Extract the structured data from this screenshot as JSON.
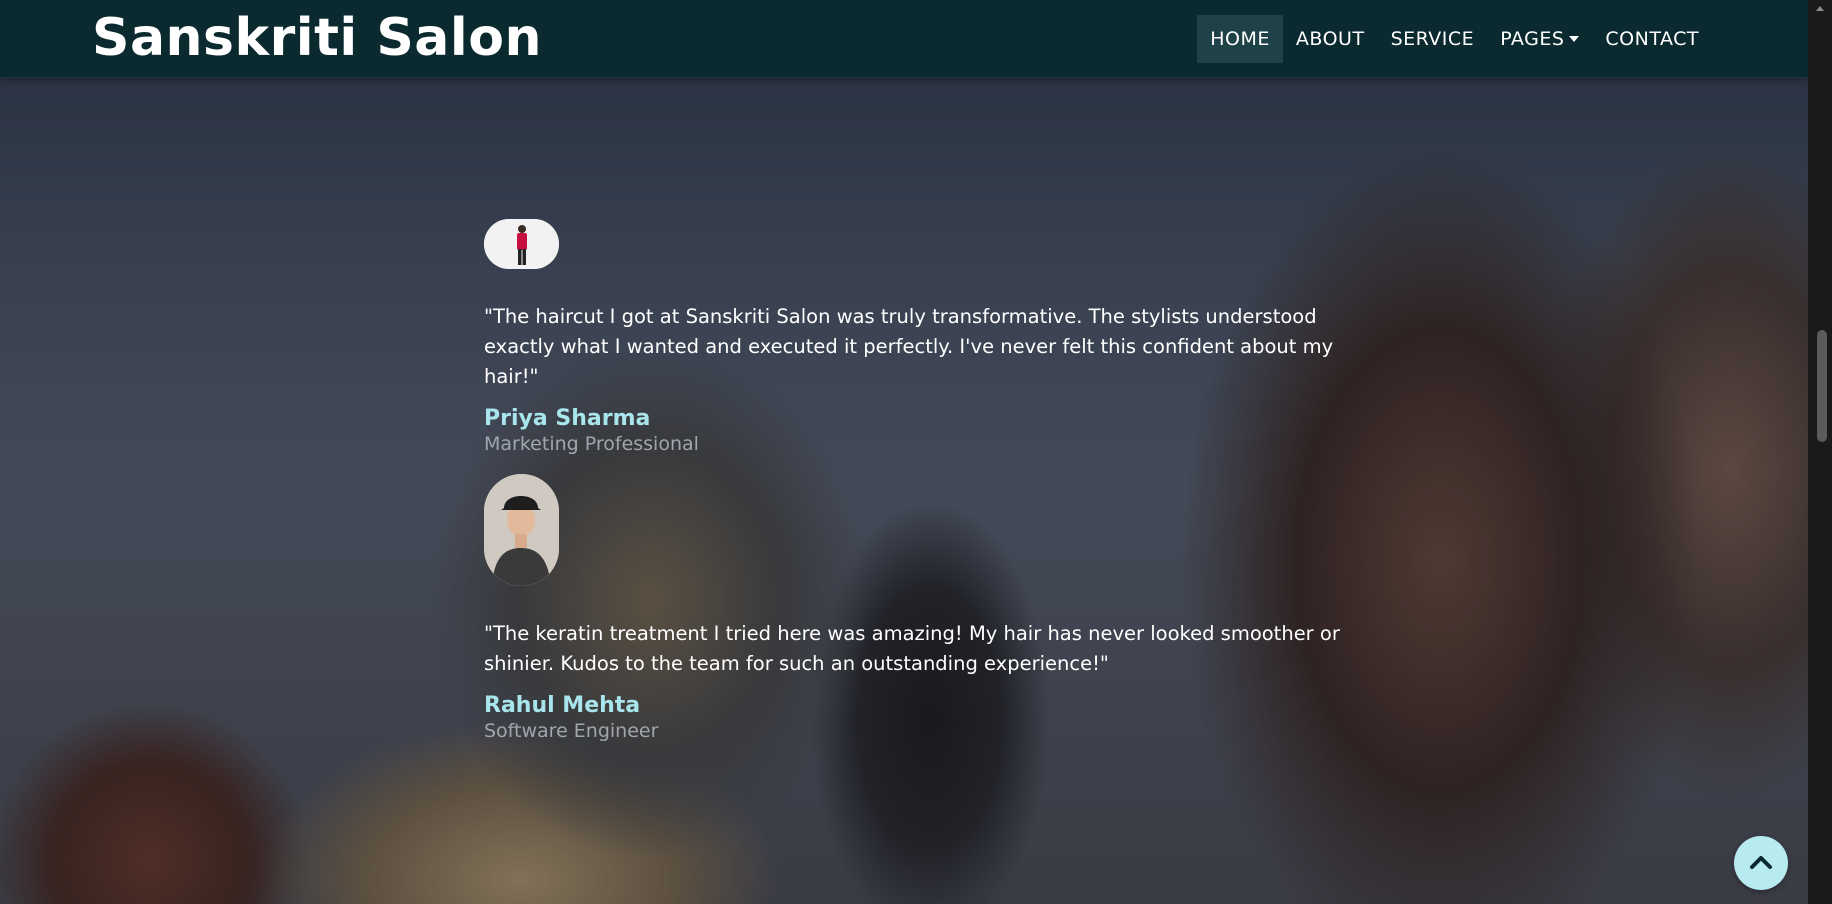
{
  "header": {
    "brand": "Sanskriti Salon",
    "nav": [
      {
        "label": "HOME",
        "active": true
      },
      {
        "label": "ABOUT"
      },
      {
        "label": "SERVICE"
      },
      {
        "label": "PAGES",
        "dropdown": true
      },
      {
        "label": "CONTACT"
      }
    ]
  },
  "testimonials": [
    {
      "quote": "\"The haircut I got at Sanskriti Salon was truly transformative. The stylists understood exactly what I wanted and executed it perfectly. I've never felt this confident about my hair!\"",
      "name": "Priya Sharma",
      "role": "Marketing Professional",
      "avatar_icon": "woman-avatar"
    },
    {
      "quote": "\"The keratin treatment I tried here was amazing! My hair has never looked smoother or shinier. Kudos to the team for such an outstanding experience!\"",
      "name": "Rahul Mehta",
      "role": "Software Engineer",
      "avatar_icon": "man-avatar"
    }
  ],
  "back_to_top_icon": "chevron-up-icon",
  "colors": {
    "navbar": "#0b2a2f",
    "nav_active": "#1f4248",
    "name_accent": "#a9e5ec",
    "back_to_top": "#b8ebf0"
  }
}
